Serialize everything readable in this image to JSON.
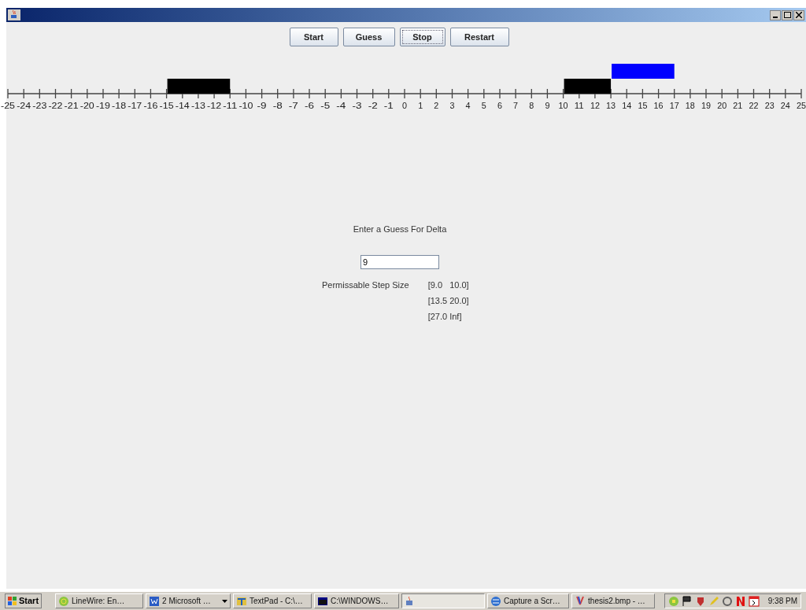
{
  "buttons": [
    {
      "label": "Start",
      "focused": false
    },
    {
      "label": "Guess",
      "focused": false
    },
    {
      "label": "Stop",
      "focused": true
    },
    {
      "label": "Restart",
      "focused": false
    }
  ],
  "number_line": {
    "ticks": [
      {
        "label": "-25",
        "lower_bar": false,
        "upper_bar": false
      },
      {
        "label": "-24",
        "lower_bar": false,
        "upper_bar": false
      },
      {
        "label": "-23",
        "lower_bar": false,
        "upper_bar": false
      },
      {
        "label": "-22",
        "lower_bar": false,
        "upper_bar": false
      },
      {
        "label": "-21",
        "lower_bar": false,
        "upper_bar": false
      },
      {
        "label": "-20",
        "lower_bar": false,
        "upper_bar": false
      },
      {
        "label": "-19",
        "lower_bar": false,
        "upper_bar": false
      },
      {
        "label": "-18",
        "lower_bar": false,
        "upper_bar": false
      },
      {
        "label": "-17",
        "lower_bar": false,
        "upper_bar": false
      },
      {
        "label": "-16",
        "lower_bar": false,
        "upper_bar": false
      },
      {
        "label": "-15",
        "lower_bar": true,
        "upper_bar": false
      },
      {
        "label": "-14",
        "lower_bar": true,
        "upper_bar": false
      },
      {
        "label": "-13",
        "lower_bar": true,
        "upper_bar": false
      },
      {
        "label": "-12",
        "lower_bar": true,
        "upper_bar": false
      },
      {
        "label": "-11",
        "lower_bar": false,
        "upper_bar": false
      },
      {
        "label": "-10",
        "lower_bar": false,
        "upper_bar": false
      },
      {
        "label": "-9",
        "lower_bar": false,
        "upper_bar": false
      },
      {
        "label": "-8",
        "lower_bar": false,
        "upper_bar": false
      },
      {
        "label": "-7",
        "lower_bar": false,
        "upper_bar": false
      },
      {
        "label": "-6",
        "lower_bar": false,
        "upper_bar": false
      },
      {
        "label": "-5",
        "lower_bar": false,
        "upper_bar": false
      },
      {
        "label": "-4",
        "lower_bar": false,
        "upper_bar": false
      },
      {
        "label": "-3",
        "lower_bar": false,
        "upper_bar": false
      },
      {
        "label": "-2",
        "lower_bar": false,
        "upper_bar": false
      },
      {
        "label": "-1",
        "lower_bar": false,
        "upper_bar": false
      },
      {
        "label": "0",
        "lower_bar": false,
        "upper_bar": false
      },
      {
        "label": "1",
        "lower_bar": false,
        "upper_bar": false
      },
      {
        "label": "2",
        "lower_bar": false,
        "upper_bar": false
      },
      {
        "label": "3",
        "lower_bar": false,
        "upper_bar": false
      },
      {
        "label": "4",
        "lower_bar": false,
        "upper_bar": false
      },
      {
        "label": "5",
        "lower_bar": false,
        "upper_bar": false
      },
      {
        "label": "6",
        "lower_bar": false,
        "upper_bar": false
      },
      {
        "label": "7",
        "lower_bar": false,
        "upper_bar": false
      },
      {
        "label": "8",
        "lower_bar": false,
        "upper_bar": false
      },
      {
        "label": "9",
        "lower_bar": false,
        "upper_bar": false
      },
      {
        "label": "10",
        "lower_bar": true,
        "upper_bar": false
      },
      {
        "label": "11",
        "lower_bar": true,
        "upper_bar": false
      },
      {
        "label": "12",
        "lower_bar": true,
        "upper_bar": false
      },
      {
        "label": "13",
        "lower_bar": false,
        "upper_bar": true
      },
      {
        "label": "14",
        "lower_bar": false,
        "upper_bar": true
      },
      {
        "label": "15",
        "lower_bar": false,
        "upper_bar": true
      },
      {
        "label": "16",
        "lower_bar": false,
        "upper_bar": true
      },
      {
        "label": "17",
        "lower_bar": false,
        "upper_bar": false
      },
      {
        "label": "18",
        "lower_bar": false,
        "upper_bar": false
      },
      {
        "label": "19",
        "lower_bar": false,
        "upper_bar": false
      },
      {
        "label": "20",
        "lower_bar": false,
        "upper_bar": false
      },
      {
        "label": "21",
        "lower_bar": false,
        "upper_bar": false
      },
      {
        "label": "22",
        "lower_bar": false,
        "upper_bar": false
      },
      {
        "label": "23",
        "lower_bar": false,
        "upper_bar": false
      },
      {
        "label": "24",
        "lower_bar": false,
        "upper_bar": false
      },
      {
        "label": "25",
        "lower_bar": false,
        "upper_bar": false
      }
    ]
  },
  "prompt": "Enter a Guess For Delta",
  "guess_field": {
    "value": "9"
  },
  "step_size": {
    "label": "Permissable Step Size",
    "intervals": [
      "[9.0   10.0]",
      "[13.5 20.0]",
      "[27.0 Inf]"
    ]
  },
  "taskbar": {
    "start": "Start",
    "items": [
      {
        "label": "LineWire: En…",
        "selected": false,
        "dropdown": false
      },
      {
        "label": "2 Microsoft …",
        "selected": false,
        "dropdown": true
      },
      {
        "label": "TextPad - C:\\…",
        "selected": false,
        "dropdown": false
      },
      {
        "label": "C:\\WINDOWS…",
        "selected": false,
        "dropdown": false
      },
      {
        "selected": true,
        "dropdown": false
      },
      {
        "label": "Capture a Scr…",
        "selected": false,
        "dropdown": false
      },
      {
        "label": "thesis2.bmp - …",
        "selected": false,
        "dropdown": false
      }
    ],
    "clock": "9:38 PM"
  }
}
